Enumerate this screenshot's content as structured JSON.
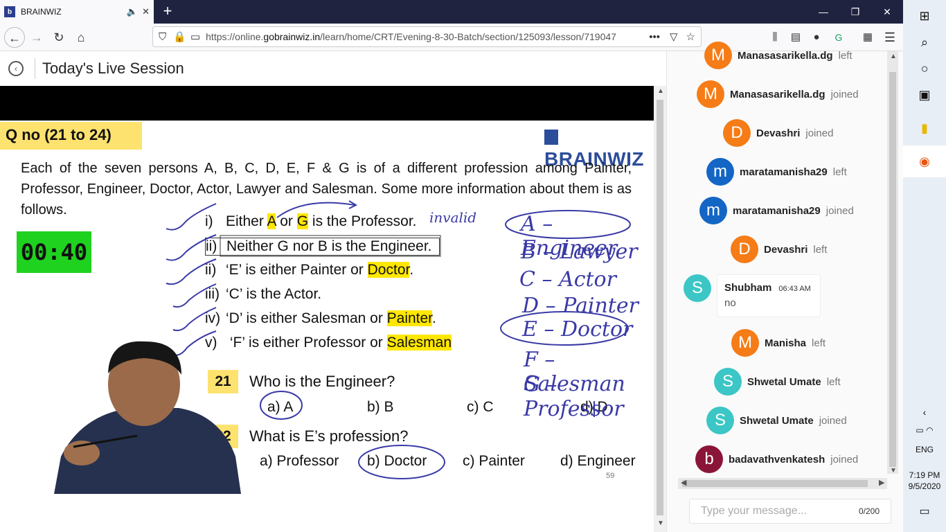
{
  "browser": {
    "tab_title": "BRAINWIZ",
    "favicon_letter": "b",
    "url_prefix": "https://online.",
    "url_domain": "gobrainwiz.in",
    "url_path": "/learn/home/CRT/Evening-8-30-Batch/section/125093/lesson/719047"
  },
  "page": {
    "title": "Today's Live Session"
  },
  "slide": {
    "qno": "Q no (21 to 24)",
    "brand": "BRAINWIZ",
    "paragraph": "Each of the seven persons A, B, C, D, E, F & G is of a different profession among Painter, Professor, Engineer, Doctor, Actor, Lawyer and Salesman. Some more information about them is as follows.",
    "timer": "00:40",
    "clues": [
      {
        "num": "i)",
        "text": "Either A or G is the Professor."
      },
      {
        "num": "ii)",
        "text": "Neither G nor B is the Engineer."
      },
      {
        "num": "ii)",
        "pre": "‘E’ is either Painter or ",
        "hl": "Doctor",
        "post": "."
      },
      {
        "num": "iii)",
        "text": "‘C’ is the Actor."
      },
      {
        "num": "iv)",
        "pre": "‘D’ is either Salesman or ",
        "hl": "Painter",
        "post": "."
      },
      {
        "num": "v)",
        "pre": " ‘F’ is either Professor or ",
        "hl": "Salesman",
        "post": ""
      }
    ],
    "clue1_parts": [
      "Either ",
      "A",
      " or ",
      "G",
      " is the Professor."
    ],
    "q21": {
      "num": "21",
      "text": "Who is the Engineer?",
      "opts": [
        "a) A",
        "b) B",
        "c) C",
        "d) D"
      ]
    },
    "q22": {
      "num": "22",
      "text": "What is E’s profession?",
      "opts": [
        "a) Professor",
        "b) Doctor",
        "c) Painter",
        "d) Engineer"
      ]
    },
    "page_number": "59",
    "handwriting": {
      "invalid": "invalid",
      "assignments": [
        "A – Engineer",
        "B – Lawyer",
        "C – Actor",
        "D – Painter",
        "E – Doctor",
        "F – Salesman",
        "G – Professor"
      ]
    }
  },
  "chat": {
    "entries": [
      {
        "initial": "M",
        "color": "#f57c17",
        "name": "Manasasarikella.dg",
        "action": "left"
      },
      {
        "initial": "M",
        "color": "#f57c17",
        "name": "Manasasarikella.dg",
        "action": "joined"
      },
      {
        "initial": "D",
        "color": "#f57c17",
        "name": "Devashri",
        "action": "joined"
      },
      {
        "initial": "m",
        "color": "#1466c4",
        "name": "maratamanisha29",
        "action": "left"
      },
      {
        "initial": "m",
        "color": "#1466c4",
        "name": "maratamanisha29",
        "action": "joined"
      },
      {
        "initial": "D",
        "color": "#f57c17",
        "name": "Devashri",
        "action": "left"
      },
      {
        "initial": "M",
        "color": "#f57c17",
        "name": "Manisha",
        "action": "left"
      },
      {
        "initial": "S",
        "color": "#3cc6c6",
        "name": "Shwetal Umate",
        "action": "left"
      },
      {
        "initial": "S",
        "color": "#3cc6c6",
        "name": "Shwetal Umate",
        "action": "joined"
      },
      {
        "initial": "b",
        "color": "#8a1538",
        "name": "badavathvenkatesh",
        "action": "joined"
      }
    ],
    "message": {
      "initial": "S",
      "color": "#3cc6c6",
      "name": "Shubham",
      "time": "06:43 AM",
      "text": "no"
    },
    "input_placeholder": "Type your message...",
    "char_count": "0/200"
  },
  "taskbar": {
    "language": "ENG",
    "time": "7:19 PM",
    "date": "9/5/2020"
  }
}
